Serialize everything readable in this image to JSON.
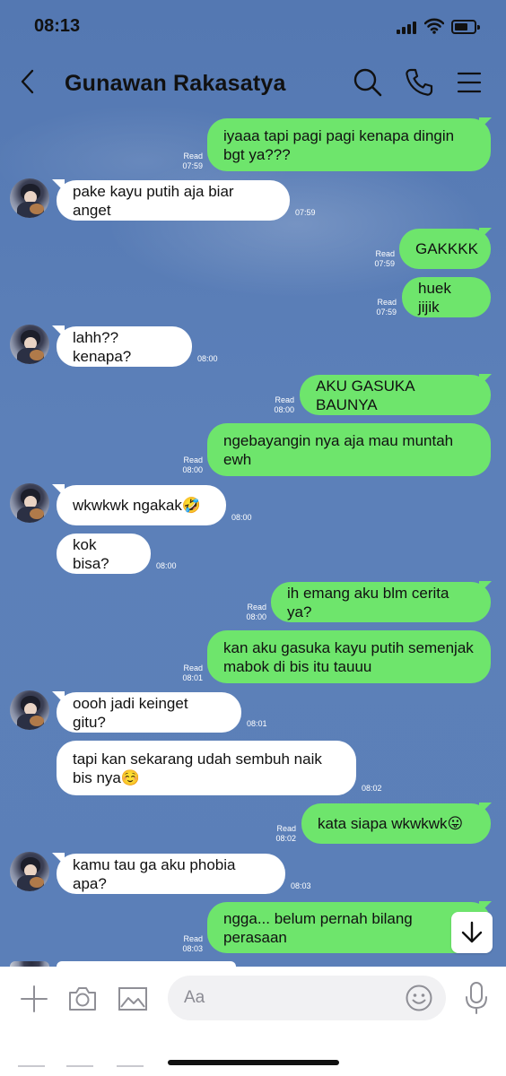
{
  "status_bar": {
    "time": "08:13"
  },
  "header": {
    "title": "Gunawan Rakasatya"
  },
  "messages": [
    {
      "side": "out",
      "text_lines": [
        "iyaaa tapi pagi pagi kenapa dingin",
        "bgt ya???"
      ],
      "read": "Read",
      "time": "07:59"
    },
    {
      "side": "in",
      "text_lines": [
        "pake kayu putih aja biar anget"
      ],
      "time": "07:59"
    },
    {
      "side": "out",
      "text_lines": [
        "GAKKKK"
      ],
      "read": "Read",
      "time": "07:59"
    },
    {
      "side": "out",
      "text_lines": [
        "huek jijik"
      ],
      "read": "Read",
      "time": "07:59"
    },
    {
      "side": "in",
      "text_lines": [
        "lahh?? kenapa?"
      ],
      "time": "08:00"
    },
    {
      "side": "out",
      "text_lines": [
        "AKU GASUKA BAUNYA"
      ],
      "read": "Read",
      "time": "08:00"
    },
    {
      "side": "out",
      "text_lines": [
        "ngebayangin nya aja mau muntah",
        "ewh"
      ],
      "read": "Read",
      "time": "08:00"
    },
    {
      "side": "in",
      "text_lines": [
        "wkwkwk ngakak🤣"
      ],
      "time": "08:00"
    },
    {
      "side": "in",
      "text_lines": [
        "kok bisa?"
      ],
      "time": "08:00"
    },
    {
      "side": "out",
      "text_lines": [
        "ih emang aku blm cerita ya?"
      ],
      "read": "Read",
      "time": "08:00"
    },
    {
      "side": "out",
      "text_lines": [
        "kan aku gasuka kayu putih semenjak",
        "mabok di bis itu tauuu"
      ],
      "read": "Read",
      "time": "08:01"
    },
    {
      "side": "in",
      "text_lines": [
        "oooh jadi keinget gitu?"
      ],
      "time": "08:01"
    },
    {
      "side": "in",
      "text_lines": [
        "tapi kan sekarang udah sembuh naik",
        "bis nya☺️"
      ],
      "time": "08:02"
    },
    {
      "side": "out",
      "text_lines": [
        "kata siapa wkwkwk😛"
      ],
      "read": "Read",
      "time": "08:02"
    },
    {
      "side": "in",
      "text_lines": [
        "kamu tau ga aku phobia apa?"
      ],
      "time": "08:03"
    },
    {
      "side": "out",
      "text_lines": [
        "ngga... belum pernah bilang",
        "perasaan"
      ],
      "read": "Read",
      "time": "08:03"
    }
  ],
  "input_bar": {
    "placeholder": "Aa"
  },
  "icons": {
    "back": "chevron-left-icon",
    "search": "search-icon",
    "call": "phone-icon",
    "menu": "menu-icon",
    "add": "plus-icon",
    "camera": "camera-icon",
    "gallery": "image-icon",
    "emoji": "smiley-icon",
    "mic": "microphone-icon",
    "scroll_down": "arrow-down-icon"
  },
  "colors": {
    "chat_background": "#5b7db5",
    "outgoing_bubble": "#6ee56c",
    "incoming_bubble": "#ffffff"
  }
}
